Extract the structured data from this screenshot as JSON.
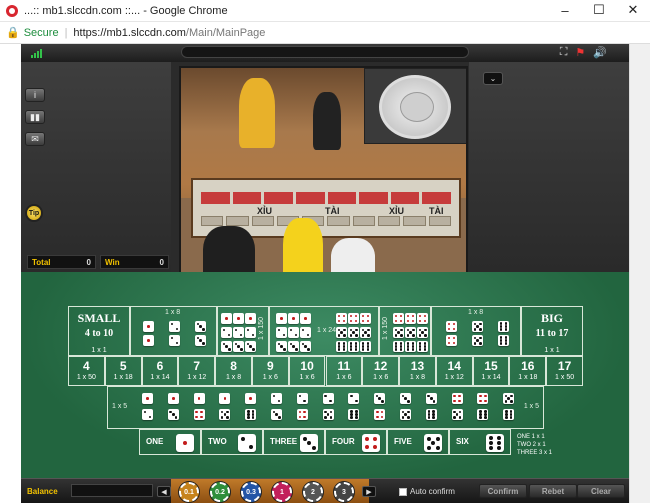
{
  "window": {
    "title": "...:: mb1.slccdn.com ::... - Google Chrome",
    "minimize": "–",
    "maximize": "☐",
    "close": "✕"
  },
  "address": {
    "secure_label": "Secure",
    "url_host": "https://mb1.slccdn.com",
    "url_path": "/Main/MainPage"
  },
  "game": {
    "tip_label": "Tip",
    "totals": {
      "total_label": "Total",
      "total_value": "0",
      "win_label": "Win",
      "win_value": "0"
    },
    "video": {
      "table_labels": [
        "XỈU",
        "TÀI",
        "XỈU",
        "TÀI"
      ]
    },
    "table": {
      "small": {
        "name": "SMALL",
        "range": "4 to 10",
        "odds": "1 x 1"
      },
      "big": {
        "name": "BIG",
        "range": "11 to 17",
        "odds": "1 x 1"
      },
      "double_odds": "1 x 8",
      "triple_odds": "1 x 150",
      "any_triple_odds": "1 x 24",
      "totals": [
        {
          "num": "4",
          "odds": "1 x 50"
        },
        {
          "num": "5",
          "odds": "1 x 18"
        },
        {
          "num": "6",
          "odds": "1 x 14"
        },
        {
          "num": "7",
          "odds": "1 x 12"
        },
        {
          "num": "8",
          "odds": "1 x 8"
        },
        {
          "num": "9",
          "odds": "1 x 6"
        },
        {
          "num": "10",
          "odds": "1 x 6"
        },
        {
          "num": "11",
          "odds": "1 x 6"
        },
        {
          "num": "12",
          "odds": "1 x 6"
        },
        {
          "num": "13",
          "odds": "1 x 8"
        },
        {
          "num": "14",
          "odds": "1 x 12"
        },
        {
          "num": "15",
          "odds": "1 x 14"
        },
        {
          "num": "16",
          "odds": "1 x 18"
        },
        {
          "num": "17",
          "odds": "1 x 50"
        }
      ],
      "combo_odds": "1 x 5",
      "singles": [
        "ONE",
        "TWO",
        "THREE",
        "FOUR",
        "FIVE",
        "SIX"
      ],
      "single_legend": [
        "ONE 1 x 1",
        "TWO 2 x 1",
        "THREE 3 x 1"
      ]
    },
    "bottom": {
      "balance_label": "Balance",
      "chips": [
        {
          "label": "0.1",
          "color": "#c6831c"
        },
        {
          "label": "0.2",
          "color": "#2f8e3b"
        },
        {
          "label": "0.3",
          "color": "#2455a6"
        },
        {
          "label": "1",
          "color": "#c21f5b"
        },
        {
          "label": "2",
          "color": "#555555"
        },
        {
          "label": "3",
          "color": "#444444"
        }
      ],
      "auto_confirm": "Auto confirm",
      "confirm": "Confirm",
      "rebet": "Rebet",
      "clear": "Clear"
    }
  }
}
